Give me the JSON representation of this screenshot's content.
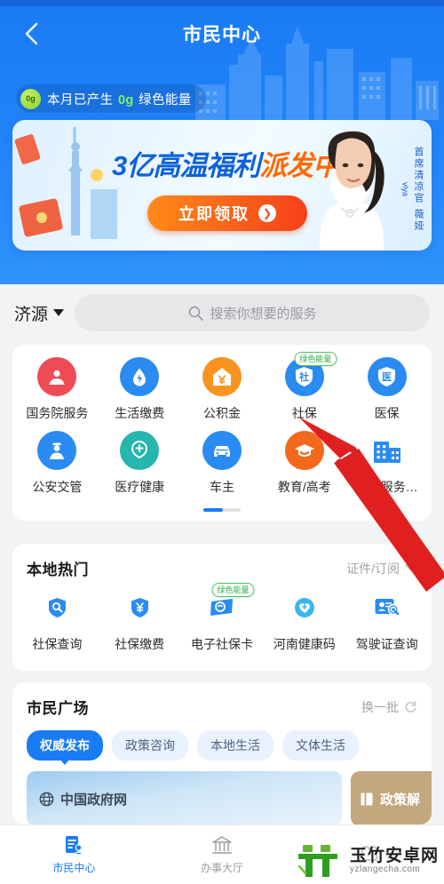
{
  "header": {
    "back_icon": "chevron-left-icon",
    "title": "市民中心",
    "energy": {
      "dot_value": "0g",
      "prefix": "本月已产生 ",
      "value": "0g",
      "suffix": " 绿色能量"
    }
  },
  "banner": {
    "title_blue": "3亿高温福利",
    "title_orange": "派发中",
    "cta_label": "立即领取",
    "cta_arrow": "arrow-right-icon",
    "side_text": "首席清凉官 薇娅",
    "side_sub": "viya"
  },
  "search": {
    "city": "济源",
    "caret_icon": "caret-down-icon",
    "search_icon": "search-icon",
    "placeholder": "搜索你想要的服务"
  },
  "services": {
    "page_indicator": "1/2",
    "items": [
      {
        "label": "国务院服务",
        "icon": "government-emblem-icon",
        "color": "#ef4b56",
        "badge": ""
      },
      {
        "label": "生活缴费",
        "icon": "water-drop-icon",
        "color": "#2a8bf2",
        "badge": ""
      },
      {
        "label": "公积金",
        "icon": "house-yuan-icon",
        "color": "#f79420",
        "badge": ""
      },
      {
        "label": "社保",
        "icon": "shield-she-icon",
        "color": "#2a8bf2",
        "badge": "绿色能量"
      },
      {
        "label": "医保",
        "icon": "shield-yi-icon",
        "color": "#2a8bf2",
        "badge": ""
      },
      {
        "label": "公安交管",
        "icon": "police-officer-icon",
        "color": "#2a8bf2",
        "badge": ""
      },
      {
        "label": "医疗健康",
        "icon": "stethoscope-icon",
        "color": "#25b6ae",
        "badge": ""
      },
      {
        "label": "车主",
        "icon": "car-icon",
        "color": "#2a8bf2",
        "badge": ""
      },
      {
        "label": "教育/高考",
        "icon": "graduation-cap-icon",
        "color": "#f2691b",
        "badge": ""
      },
      {
        "label": "疫情服务…",
        "icon": "hospital-building-icon",
        "color": "#2a8bf2",
        "badge": ""
      }
    ]
  },
  "local_hot": {
    "title": "本地热门",
    "action_label": "证件/订阅",
    "action_icon": "chevron-down-icon",
    "items": [
      {
        "label": "社保查询",
        "icon": "shield-search-icon",
        "color": "#2a8bf2",
        "badge": ""
      },
      {
        "label": "社保缴费",
        "icon": "shield-yuan-icon",
        "color": "#2a8bf2",
        "badge": ""
      },
      {
        "label": "电子社保卡",
        "icon": "social-card-icon",
        "color": "#2a8bf2",
        "badge": "绿色能量"
      },
      {
        "label": "河南健康码",
        "icon": "heart-plus-icon",
        "color": "#3ab5ef",
        "badge": ""
      },
      {
        "label": "驾驶证查询",
        "icon": "id-search-icon",
        "color": "#2a8bf2",
        "badge": ""
      }
    ]
  },
  "plaza": {
    "title": "市民广场",
    "refresh_label": "换一批",
    "refresh_icon": "refresh-icon",
    "tabs": [
      {
        "label": "权威发布",
        "active": true
      },
      {
        "label": "政策咨询",
        "active": false
      },
      {
        "label": "本地生活",
        "active": false
      },
      {
        "label": "文体生活",
        "active": false
      }
    ],
    "feeds": [
      {
        "label": "中国政府网",
        "icon": "globe-icon"
      },
      {
        "label": "政策解",
        "icon": "book-icon"
      }
    ]
  },
  "tabbar": [
    {
      "label": "市民中心",
      "icon": "citizen-center-icon",
      "active": true
    },
    {
      "label": "办事大厅",
      "icon": "bank-hall-icon",
      "active": false
    },
    {
      "label": "",
      "icon": "my-account-icon",
      "active": false
    }
  ],
  "annotation": {
    "arrow_icon": "pointer-arrow-icon",
    "color": "#e02020"
  },
  "watermark": {
    "main": "玉竹安卓网",
    "sub": "yzlangecha.com",
    "color": "#3aa02c"
  }
}
